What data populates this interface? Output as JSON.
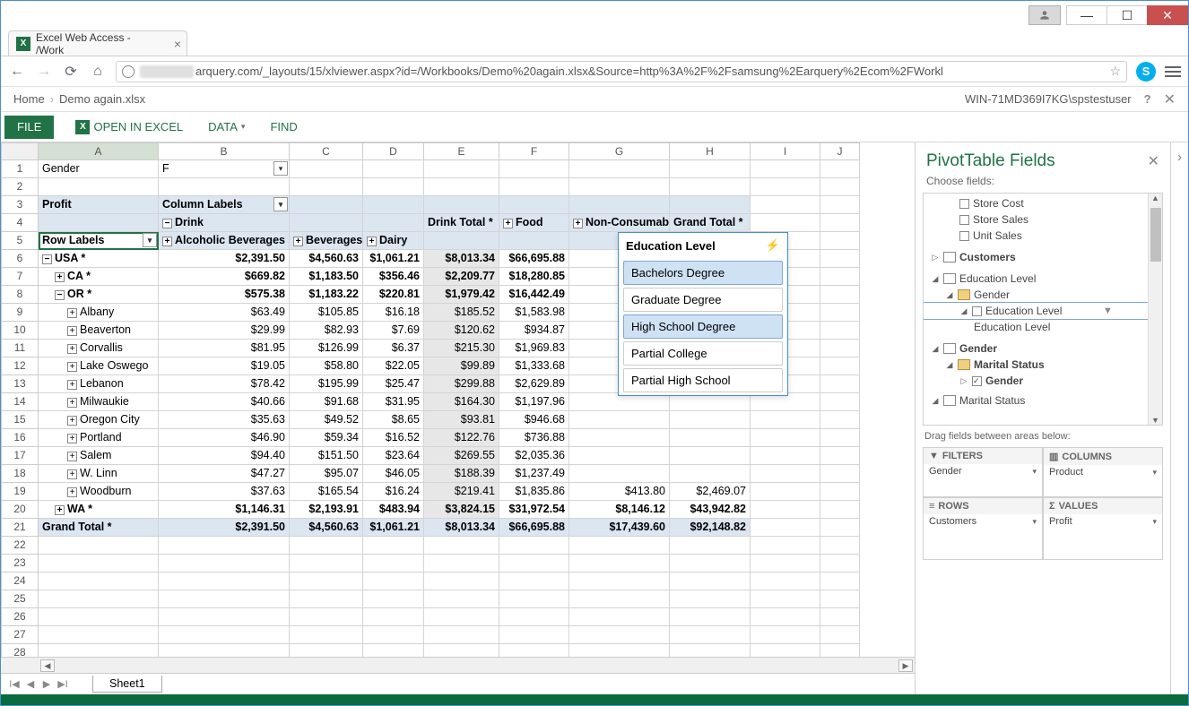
{
  "window": {
    "title": "Excel Web Access - /Work"
  },
  "url": {
    "visible": "arquery.com/_layouts/15/xlviewer.aspx?id=/Workbooks/Demo%20again.xlsx&Source=http%3A%2F%2Fsamsung%2Earquery%2Ecom%2FWorkl"
  },
  "breadcrumb": {
    "home": "Home",
    "file": "Demo again.xlsx"
  },
  "account": "WIN-71MD369I7KG\\spstestuser",
  "ribbon": {
    "file": "FILE",
    "open": "OPEN IN EXCEL",
    "data": "DATA",
    "find": "FIND"
  },
  "columns": [
    "A",
    "B",
    "C",
    "D",
    "E",
    "F",
    "G",
    "H",
    "I",
    "J"
  ],
  "pivot": {
    "filter_label": "Gender",
    "filter_value": "F",
    "profit": "Profit",
    "col_labels": "Column Labels",
    "drink": "Drink",
    "alc": "Alcoholic Beverages",
    "bev": "Beverages",
    "dairy": "Dairy",
    "drink_total": "Drink Total *",
    "food": "Food",
    "nonc": "Non-Consumable",
    "gt": "Grand Total *",
    "rowlabels": "Row Labels"
  },
  "rows": [
    {
      "n": 6,
      "label": "USA *",
      "lvl": 0,
      "exp": "−",
      "b": "$2,391.50",
      "c": "$4,560.63",
      "d": "$1,061.21",
      "e": "$8,013.34",
      "f": "$66,695.88",
      "bold": true
    },
    {
      "n": 7,
      "label": "CA *",
      "lvl": 1,
      "exp": "+",
      "b": "$669.82",
      "c": "$1,183.50",
      "d": "$356.46",
      "e": "$2,209.77",
      "f": "$18,280.85",
      "bold": true
    },
    {
      "n": 8,
      "label": "OR *",
      "lvl": 1,
      "exp": "−",
      "b": "$575.38",
      "c": "$1,183.22",
      "d": "$220.81",
      "e": "$1,979.42",
      "f": "$16,442.49",
      "bold": true
    },
    {
      "n": 9,
      "label": "Albany",
      "lvl": 2,
      "exp": "+",
      "b": "$63.49",
      "c": "$105.85",
      "d": "$16.18",
      "e": "$185.52",
      "f": "$1,583.98"
    },
    {
      "n": 10,
      "label": "Beaverton",
      "lvl": 2,
      "exp": "+",
      "b": "$29.99",
      "c": "$82.93",
      "d": "$7.69",
      "e": "$120.62",
      "f": "$934.87"
    },
    {
      "n": 11,
      "label": "Corvallis",
      "lvl": 2,
      "exp": "+",
      "b": "$81.95",
      "c": "$126.99",
      "d": "$6.37",
      "e": "$215.30",
      "f": "$1,969.83"
    },
    {
      "n": 12,
      "label": "Lake Oswego",
      "lvl": 2,
      "exp": "+",
      "b": "$19.05",
      "c": "$58.80",
      "d": "$22.05",
      "e": "$99.89",
      "f": "$1,333.68"
    },
    {
      "n": 13,
      "label": "Lebanon",
      "lvl": 2,
      "exp": "+",
      "b": "$78.42",
      "c": "$195.99",
      "d": "$25.47",
      "e": "$299.88",
      "f": "$2,629.89"
    },
    {
      "n": 14,
      "label": "Milwaukie",
      "lvl": 2,
      "exp": "+",
      "b": "$40.66",
      "c": "$91.68",
      "d": "$31.95",
      "e": "$164.30",
      "f": "$1,197.96"
    },
    {
      "n": 15,
      "label": "Oregon City",
      "lvl": 2,
      "exp": "+",
      "b": "$35.63",
      "c": "$49.52",
      "d": "$8.65",
      "e": "$93.81",
      "f": "$946.68"
    },
    {
      "n": 16,
      "label": "Portland",
      "lvl": 2,
      "exp": "+",
      "b": "$46.90",
      "c": "$59.34",
      "d": "$16.52",
      "e": "$122.76",
      "f": "$736.88"
    },
    {
      "n": 17,
      "label": "Salem",
      "lvl": 2,
      "exp": "+",
      "b": "$94.40",
      "c": "$151.50",
      "d": "$23.64",
      "e": "$269.55",
      "f": "$2,035.36"
    },
    {
      "n": 18,
      "label": "W. Linn",
      "lvl": 2,
      "exp": "+",
      "b": "$47.27",
      "c": "$95.07",
      "d": "$46.05",
      "e": "$188.39",
      "f": "$1,237.49"
    },
    {
      "n": 19,
      "label": "Woodburn",
      "lvl": 2,
      "exp": "+",
      "b": "$37.63",
      "c": "$165.54",
      "d": "$16.24",
      "e": "$219.41",
      "f": "$1,835.86",
      "g": "$413.80",
      "h": "$2,469.07"
    },
    {
      "n": 20,
      "label": "WA *",
      "lvl": 1,
      "exp": "+",
      "b": "$1,146.31",
      "c": "$2,193.91",
      "d": "$483.94",
      "e": "$3,824.15",
      "f": "$31,972.54",
      "g": "$8,146.12",
      "h": "$43,942.82",
      "bold": true
    }
  ],
  "grand": {
    "label": "Grand Total *",
    "b": "$2,391.50",
    "c": "$4,560.63",
    "d": "$1,061.21",
    "e": "$8,013.34",
    "f": "$66,695.88",
    "g": "$17,439.60",
    "h": "$92,148.82"
  },
  "slicer": {
    "title": "Education Level",
    "items": [
      {
        "t": "Bachelors Degree",
        "on": true
      },
      {
        "t": "Graduate Degree",
        "on": false
      },
      {
        "t": "High School Degree",
        "on": true
      },
      {
        "t": "Partial College",
        "on": false
      },
      {
        "t": "Partial High School",
        "on": false
      }
    ]
  },
  "fieldlist": {
    "title": "PivotTable Fields",
    "choose": "Choose fields:",
    "top": [
      {
        "t": "Store Cost"
      },
      {
        "t": "Store Sales"
      },
      {
        "t": "Unit Sales"
      }
    ],
    "customers": "Customers",
    "edulevel": "Education Level",
    "gender_folder": "Gender",
    "edulevel2": "Education Level",
    "edulevel3": "Education Level",
    "gender": "Gender",
    "marital_folder": "Marital Status",
    "gender_cb": "Gender",
    "marital": "Marital Status",
    "drag": "Drag fields between areas below:",
    "boxes": {
      "filters": "FILTERS",
      "filters_item": "Gender",
      "columns": "COLUMNS",
      "columns_item": "Product",
      "rows": "ROWS",
      "rows_item": "Customers",
      "values": "VALUES",
      "values_item": "Profit"
    }
  },
  "sheet": "Sheet1"
}
